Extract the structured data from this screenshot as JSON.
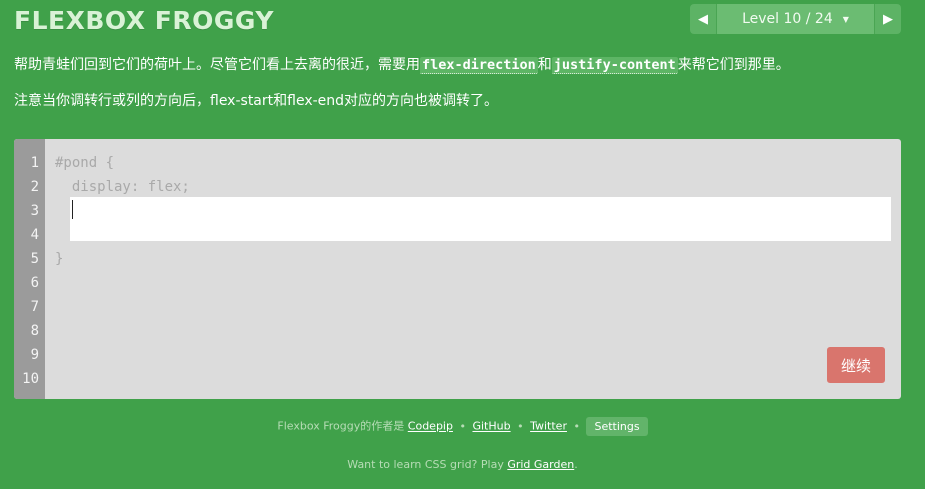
{
  "header": {
    "title": "FLEXBOX FROGGY",
    "level_label": "Level 10 / 24",
    "prev_arrow": "◀",
    "next_arrow": "▶",
    "caret": "▼"
  },
  "instructions": {
    "p1_before": "帮助青蛙们回到它们的荷叶上。尽管它们看上去离的很近，需要用",
    "p1_code1": "flex-direction",
    "p1_mid": "和",
    "p1_code2": "justify-content",
    "p1_after": "来帮它们到那里。",
    "p2": "注意当你调转行或列的方向后，flex-start和flex-end对应的方向也被调转了。"
  },
  "editor": {
    "line_numbers": [
      "1",
      "2",
      "3",
      "4",
      "5",
      "6",
      "7",
      "8",
      "9",
      "10"
    ],
    "lines": [
      "#pond {",
      "  display: flex;",
      "",
      "",
      "}"
    ],
    "input_value": "",
    "next_button_label": "继续"
  },
  "footer": {
    "credit_prefix": "Flexbox Froggy的作者是",
    "codepip": "Codepip",
    "github": "GitHub",
    "twitter": "Twitter",
    "settings": "Settings",
    "bullet": "•",
    "grid_prefix": "Want to learn CSS grid? Play",
    "grid_garden": "Grid Garden",
    "grid_suffix": "."
  },
  "colors": {
    "background": "#40a14a",
    "editor_bg": "#dcdcdc",
    "gutter_bg": "#9b9b9b",
    "next_button": "#d9756d"
  }
}
